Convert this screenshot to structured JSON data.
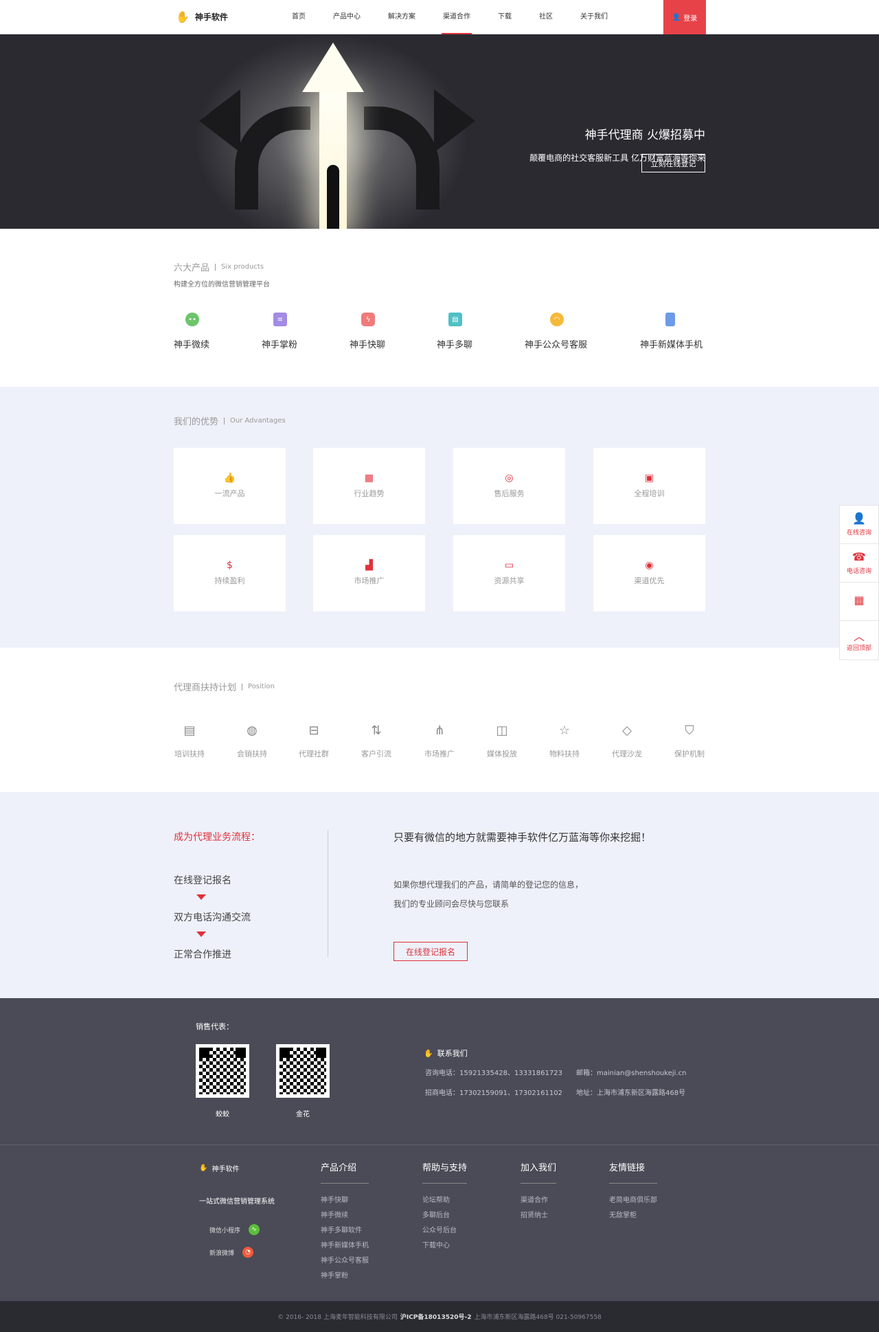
{
  "header": {
    "brand": "神手软件",
    "nav": [
      "首页",
      "产品中心",
      "解决方案",
      "渠道合作",
      "下载",
      "社区",
      "关于我们"
    ],
    "active_nav": "渠道合作",
    "login": "登录"
  },
  "banner": {
    "title": "神手代理商 火爆招募中",
    "subtitle": "颠覆电商的社交客服新工具 亿万财富蓝海等你来",
    "button": "立刻在线登记"
  },
  "products": {
    "title": "六大产品",
    "title_en": "Six products",
    "subtitle": "构建全方位的微信营销管理平台",
    "items": [
      {
        "label": "神手微续",
        "icon": "chat-bubble-icon",
        "color": "#6cc56a"
      },
      {
        "label": "神手掌粉",
        "icon": "database-icon",
        "color": "#a38be6"
      },
      {
        "label": "神手快聊",
        "icon": "lightning-chat-icon",
        "color": "#f07b7b"
      },
      {
        "label": "神手多聊",
        "icon": "multi-chat-icon",
        "color": "#4fc1c6"
      },
      {
        "label": "神手公众号客服",
        "icon": "headset-icon",
        "color": "#f5b93a"
      },
      {
        "label": "神手新媒体手机",
        "icon": "phone-icon",
        "color": "#6d9bea"
      }
    ]
  },
  "advantages": {
    "title": "我们的优势",
    "title_en": "Our Advantages",
    "items": [
      {
        "label": "一流产品",
        "icon": "thumbs-up-icon"
      },
      {
        "label": "行业趋势",
        "icon": "building-icon"
      },
      {
        "label": "售后服务",
        "icon": "service-icon"
      },
      {
        "label": "全程培训",
        "icon": "training-icon"
      },
      {
        "label": "持续盈利",
        "icon": "money-bag-icon"
      },
      {
        "label": "市场推广",
        "icon": "bar-chart-icon"
      },
      {
        "label": "资源共享",
        "icon": "screen-share-icon"
      },
      {
        "label": "渠道优先",
        "icon": "target-icon"
      }
    ]
  },
  "support": {
    "title": "代理商扶持计划",
    "title_en": "Position",
    "items": [
      {
        "label": "培训扶持",
        "icon": "id-card-icon"
      },
      {
        "label": "会销扶持",
        "icon": "trend-circle-icon"
      },
      {
        "label": "代理社群",
        "icon": "briefcase-icon"
      },
      {
        "label": "客户引流",
        "icon": "transfer-icon"
      },
      {
        "label": "市场推广",
        "icon": "share-icon"
      },
      {
        "label": "媒体投放",
        "icon": "video-camera-icon"
      },
      {
        "label": "物料扶持",
        "icon": "star-icon"
      },
      {
        "label": "代理沙龙",
        "icon": "tag-icon"
      },
      {
        "label": "保护机制",
        "icon": "shield-icon"
      }
    ]
  },
  "process": {
    "title": "成为代理业务流程：",
    "steps": [
      "在线登记报名",
      "双方电话沟通交流",
      "正常合作推进"
    ],
    "headline": "只要有微信的地方就需要神手软件亿万蓝海等你来挖掘！",
    "para1": "如果你想代理我们的产品，请简单的登记您的信息，",
    "para2": "我们的专业顾问会尽快与您联系",
    "button": "在线登记报名"
  },
  "contact": {
    "sales_title": "销售代表：",
    "reps": [
      {
        "name": "蛟蛟"
      },
      {
        "name": "金花"
      }
    ],
    "heading": "联系我们",
    "consult_phone": "咨询电话：15921335428、13331861723",
    "email": "邮箱：mainian@shenshoukeji.cn",
    "recruit_phone": "招商电话：17302159091、17302161102",
    "address": "地址：上海市浦东新区海露路468号"
  },
  "footer": {
    "brand": "神手软件",
    "slogan": "一站式微信营销管理系统",
    "social": [
      {
        "label": "微信小程序",
        "icon": "mini-program-icon",
        "color": "#5cbf3c"
      },
      {
        "label": "新浪微博",
        "icon": "weibo-icon",
        "color": "#f05a3b"
      }
    ],
    "columns": [
      {
        "title": "产品介绍",
        "items": [
          "神手快聊",
          "神手微续",
          "神手多聊软件",
          "神手新媒体手机",
          "神手公众号客服",
          "神手掌粉"
        ]
      },
      {
        "title": "帮助与支持",
        "items": [
          "论坛帮助",
          "多聊后台",
          "公众号后台",
          "下载中心"
        ]
      },
      {
        "title": "加入我们",
        "items": [
          "渠道合作",
          "招贤纳士"
        ]
      },
      {
        "title": "友情链接",
        "items": [
          "老简电商俱乐部",
          "无敌掌柜"
        ]
      }
    ],
    "copyright_pre": "© 2016- 2018 上海麦年智能科技有限公司",
    "icp": "沪ICP备18013520号-2",
    "copyright_post": "上海市浦东新区海露路468号 021-50967558"
  },
  "side_tools": [
    {
      "label": "在线咨询",
      "icon": "user-icon"
    },
    {
      "label": "电话咨询",
      "icon": "telephone-icon"
    },
    {
      "label": "",
      "icon": "qr-code-icon"
    },
    {
      "label": "返回顶部",
      "icon": "chevron-up-icon"
    }
  ]
}
